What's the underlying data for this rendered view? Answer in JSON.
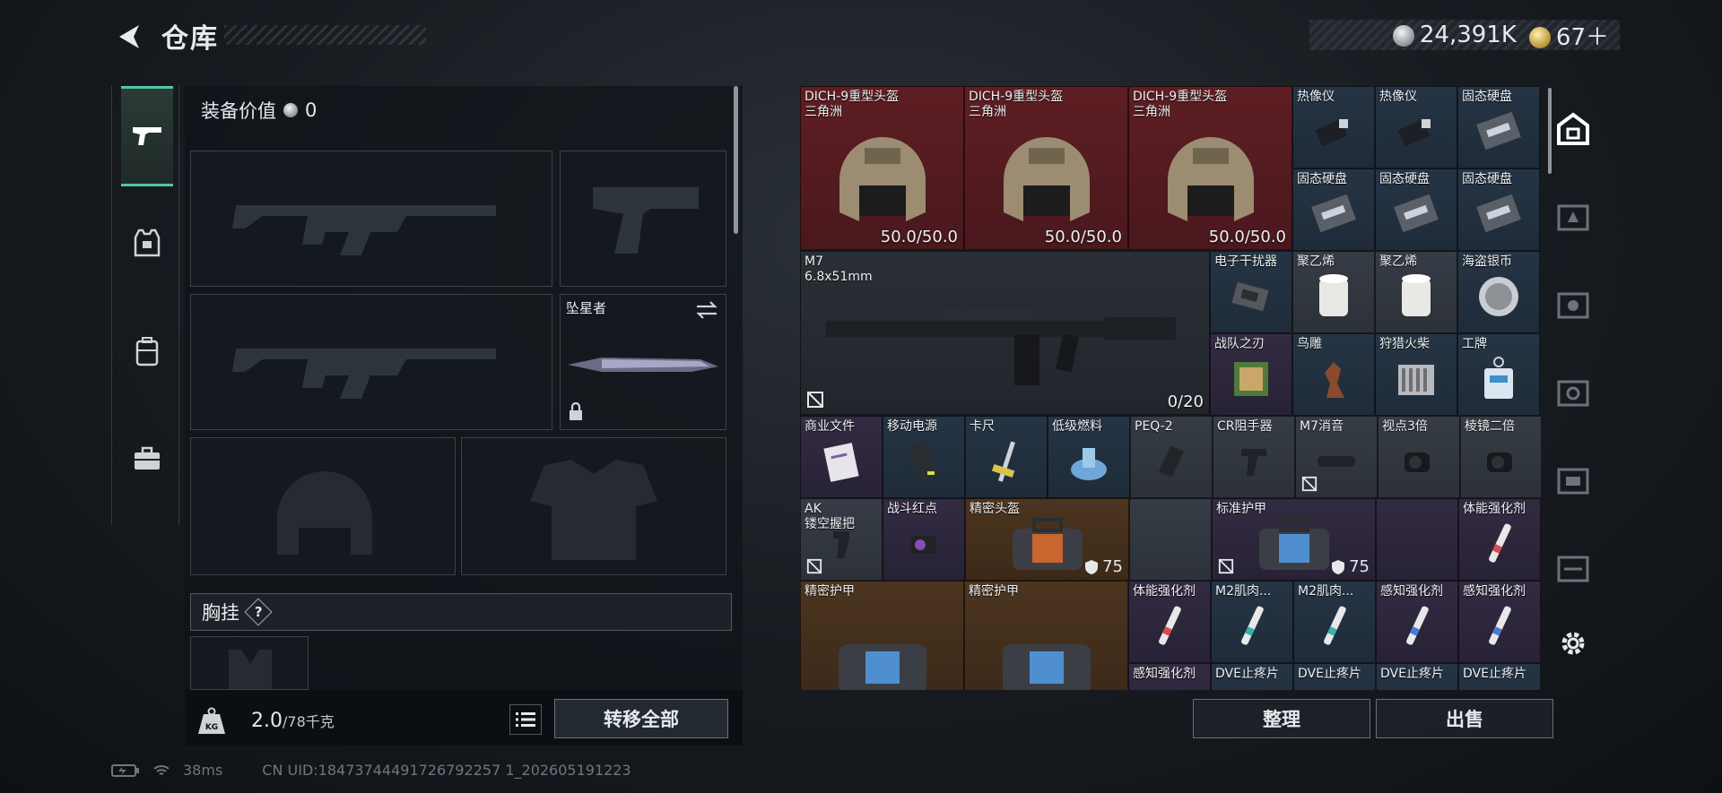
{
  "header": {
    "title": "仓库"
  },
  "currency": {
    "money": "24,391K",
    "tokens": "67＋"
  },
  "left": {
    "equip_value_label": "装备价值",
    "equip_value": "0",
    "melee_slot_name": "坠星者",
    "chest_rig_label": "胸挂",
    "chest_rig_badge": "?",
    "weight_value": "2.0",
    "weight_max": "/78千克",
    "transfer_all": "转移全部"
  },
  "grid": {
    "helmet_name": "DICH-9重型头盔",
    "helmet_sub": "三角洲",
    "helmet_durability": "50.0/50.0",
    "thermal": "热像仪",
    "ssd": "固态硬盘",
    "m7_name": "M7",
    "m7_ammo": "6.8x51mm",
    "m7_count": "0/20",
    "jammer": "电子干扰器",
    "polyethylene": "聚乙烯",
    "pirate_coin": "海盗银币",
    "squad_blade": "战队之刃",
    "bird_statue": "鸟雕",
    "hunting_match": "狩猎火柴",
    "work_badge": "工牌",
    "business_doc": "商业文件",
    "power_bank": "移动电源",
    "caliper": "卡尺",
    "low_fuel": "低级燃料",
    "peq2": "PEQ-2",
    "cr_grip": "CR阻手器",
    "m7_suppressor": "M7消音",
    "scope3x": "视点3倍",
    "prism2x": "棱镜二倍",
    "ak_grip_1": "AK",
    "ak_grip_2": "镂空握把",
    "red_dot": "战斗红点",
    "precision_helmet": "精密头盔",
    "precision_helmet_val": "75",
    "standard_armor": "标准护甲",
    "standard_armor_val": "75",
    "stamina_inj": "体能强化剂",
    "precision_armor": "精密护甲",
    "m2_muscle": "M2肌肉...",
    "perception_inj": "感知强化剂",
    "dve_painkiller": "DVE止疼片"
  },
  "buttons": {
    "organize": "整理",
    "sell": "出售"
  },
  "status": {
    "ping": "38ms",
    "uid": "CN UID:18473744491726792257 1_202605191223"
  }
}
